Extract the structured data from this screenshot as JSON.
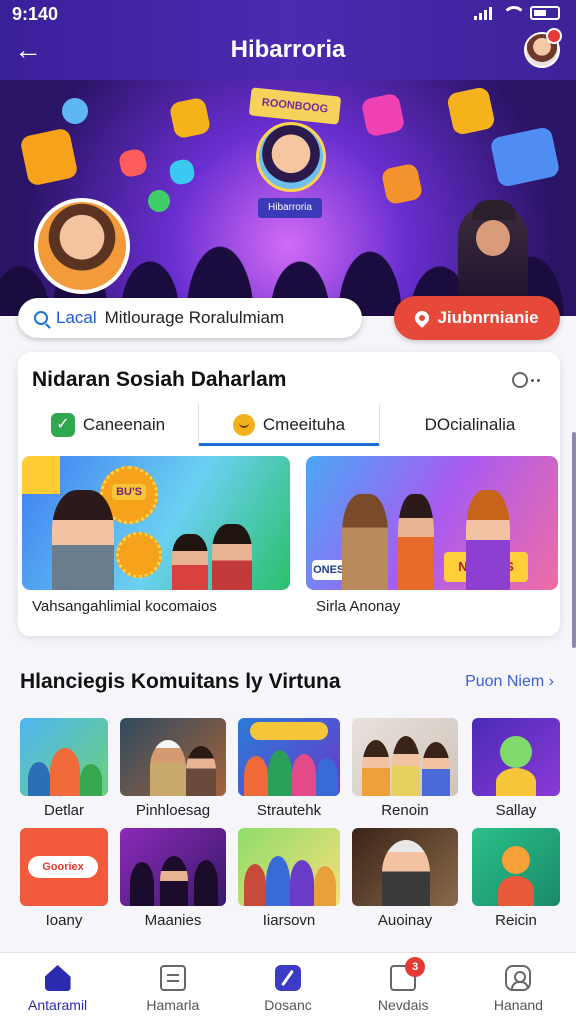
{
  "status": {
    "time": "9:140"
  },
  "header": {
    "title": "Hibarroria",
    "back_icon": "arrow-left-icon"
  },
  "hero": {
    "sign_top": "ROONBOOG",
    "sign_bottom": "Hibarroria"
  },
  "search": {
    "location": "Lacal",
    "query": "Mitlourage  Roralulmiam"
  },
  "cta": {
    "label": "Jiubnrnianie",
    "icon": "location-pin-icon"
  },
  "card": {
    "title": "Nidaran Sosiah Daharlam",
    "tabs": [
      {
        "label": "Caneenain",
        "icon": "check-icon"
      },
      {
        "label": "Cmeeituha",
        "icon": "face-icon"
      },
      {
        "label": "DOcialinalia"
      }
    ],
    "features": [
      {
        "caption": "Vahsangahlimial kocomaios",
        "badge": "BU'S"
      },
      {
        "caption": "Sirla Anonay",
        "badge": "NAURUS",
        "badge2": "ONES BING"
      }
    ]
  },
  "community": {
    "title": "Hlanciegis Komuitans ly Virtuna",
    "link": "Puon Niem",
    "items": [
      {
        "label": "Detlar"
      },
      {
        "label": "Pinhloesag"
      },
      {
        "label": "Strautehk"
      },
      {
        "label": "Renoin"
      },
      {
        "label": "Sallay"
      },
      {
        "label": "Ioany",
        "chip": "Gooriex"
      },
      {
        "label": "Maanies"
      },
      {
        "label": "Iiarsovn"
      },
      {
        "label": "Auoinay"
      },
      {
        "label": "Reicin"
      }
    ]
  },
  "nav": {
    "items": [
      {
        "label": "Antaramil",
        "icon": "home-icon"
      },
      {
        "label": "Hamarla",
        "icon": "document-icon"
      },
      {
        "label": "Dosanc",
        "icon": "pen-icon"
      },
      {
        "label": "Nevdais",
        "icon": "message-icon",
        "badge": "3"
      },
      {
        "label": "Hanand",
        "icon": "user-icon"
      }
    ]
  },
  "colors": {
    "header": "#4b2bb0",
    "accent": "#e6483a",
    "link": "#3b5fd6",
    "tab_active": "#1a6ed8"
  }
}
